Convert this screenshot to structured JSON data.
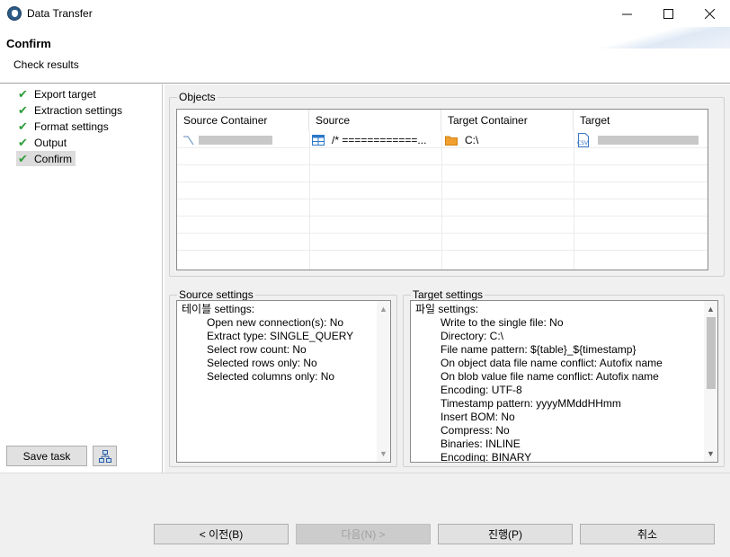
{
  "window": {
    "title": "Data Transfer",
    "minimize": "—",
    "maximize": "☐",
    "close": "✕"
  },
  "header": {
    "title": "Confirm",
    "subtitle": "Check results"
  },
  "sidebar": {
    "items": [
      {
        "label": "Export target",
        "check": "✔"
      },
      {
        "label": "Extraction settings",
        "check": "✔"
      },
      {
        "label": "Format settings",
        "check": "✔"
      },
      {
        "label": "Output",
        "check": "✔"
      },
      {
        "label": "Confirm",
        "check": "✔",
        "selected": true
      }
    ],
    "save_task_label": "Save task"
  },
  "objects": {
    "group_label": "Objects",
    "columns": [
      "Source Container",
      "Source",
      "Target Container",
      "Target"
    ],
    "rows": [
      {
        "source": "/* ============...",
        "target_container": "C:\\"
      }
    ]
  },
  "source_settings": {
    "group_label": "Source settings",
    "lines": [
      "테이블 settings:",
      "Open new connection(s): No",
      "Extract type: SINGLE_QUERY",
      "Select row count: No",
      "Selected rows only: No",
      "Selected columns only: No"
    ]
  },
  "target_settings": {
    "group_label": "Target settings",
    "lines": [
      "파일 settings:",
      "Write to the single file: No",
      "Directory: C:\\",
      "File name pattern: ${table}_${timestamp}",
      "On object data file name conflict: Autofix name",
      "On blob value file name conflict: Autofix name",
      "Encoding: UTF-8",
      "Timestamp pattern: yyyyMMddHHmm",
      "Insert BOM: No",
      "Compress: No",
      "Binaries: INLINE",
      "Encoding: BINARY"
    ]
  },
  "footer": {
    "prev": "< 이전(B)",
    "next": "다음(N) >",
    "proceed": "진행(P)",
    "cancel": "취소"
  },
  "colors": {
    "check": "#2e9e3a",
    "selected_bg": "#dcdcdc",
    "panel_bg": "#f0f0f0"
  }
}
